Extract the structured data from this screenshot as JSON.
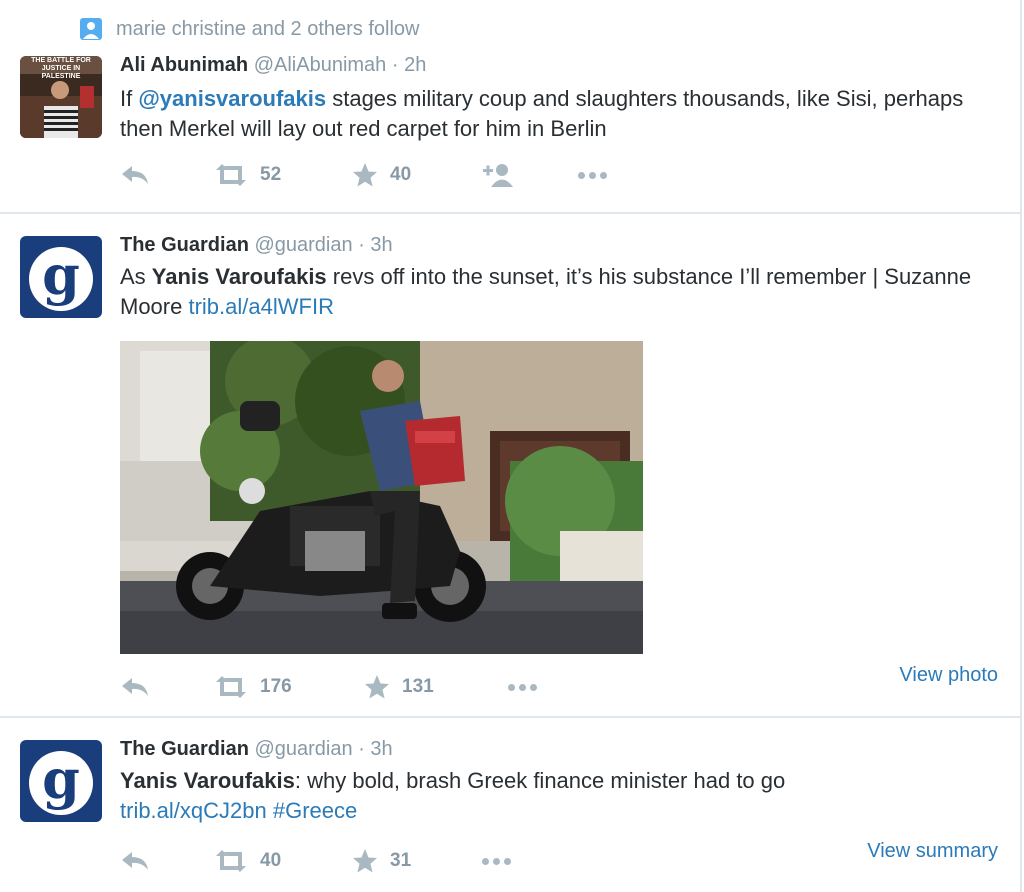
{
  "context": {
    "text": "marie christine and 2 others follow"
  },
  "tweets": [
    {
      "name": "Ali Abunimah",
      "handle": "@AliAbunimah",
      "time": "· 2h",
      "text_before": "If ",
      "mention": "@yanisvaroufakis",
      "text_after": " stages military coup and slaughters thousands, like Sisi, perhaps then Merkel will lay out red carpet for him in Berlin",
      "avatar_caption": "THE BATTLE FOR JUSTICE IN PALESTINE",
      "retweets": "52",
      "favorites": "40"
    },
    {
      "name": "The Guardian",
      "handle": "@guardian",
      "time": "· 3h",
      "text_before": "As ",
      "bold": "Yanis Varoufakis",
      "text_after": " revs off into the sunset, it’s his substance I’ll remember | Suzanne Moore ",
      "link": "trib.al/a4lWFIR",
      "retweets": "176",
      "favorites": "131",
      "view_link": "View photo"
    },
    {
      "name": "The Guardian",
      "handle": "@guardian",
      "time": "· 3h",
      "bold": "Yanis Varoufakis",
      "text_after": ": why bold, brash Greek finance minister had to go",
      "link": "trib.al/xqCJ2bn",
      "hashtag": "#Greece",
      "retweets": "40",
      "favorites": "31",
      "view_link": "View summary"
    }
  ],
  "colors": {
    "link": "#2b7bb9",
    "muted": "#8899a6",
    "guardian_blue": "#1a3d7c",
    "border": "#e1e8ed"
  },
  "icons": [
    "user-icon",
    "reply-icon",
    "retweet-icon",
    "star-icon",
    "follow-icon",
    "more-icon"
  ]
}
